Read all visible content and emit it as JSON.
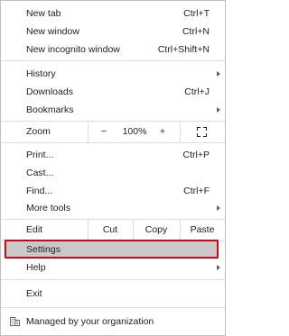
{
  "menu": {
    "new_tab": {
      "label": "New tab",
      "shortcut": "Ctrl+T"
    },
    "new_window": {
      "label": "New window",
      "shortcut": "Ctrl+N"
    },
    "new_incognito": {
      "label": "New incognito window",
      "shortcut": "Ctrl+Shift+N"
    },
    "history": {
      "label": "History"
    },
    "downloads": {
      "label": "Downloads",
      "shortcut": "Ctrl+J"
    },
    "bookmarks": {
      "label": "Bookmarks"
    },
    "zoom": {
      "label": "Zoom",
      "minus": "−",
      "value": "100%",
      "plus": "+"
    },
    "print": {
      "label": "Print...",
      "shortcut": "Ctrl+P"
    },
    "cast": {
      "label": "Cast..."
    },
    "find": {
      "label": "Find...",
      "shortcut": "Ctrl+F"
    },
    "more_tools": {
      "label": "More tools"
    },
    "edit": {
      "label": "Edit",
      "cut": "Cut",
      "copy": "Copy",
      "paste": "Paste"
    },
    "settings": {
      "label": "Settings"
    },
    "help": {
      "label": "Help"
    },
    "exit": {
      "label": "Exit"
    },
    "managed": {
      "label": "Managed by your organization",
      "icon": "building-icon"
    }
  },
  "colors": {
    "highlight_border": "#d0021b",
    "highlight_fill": "#c9c9c9"
  }
}
